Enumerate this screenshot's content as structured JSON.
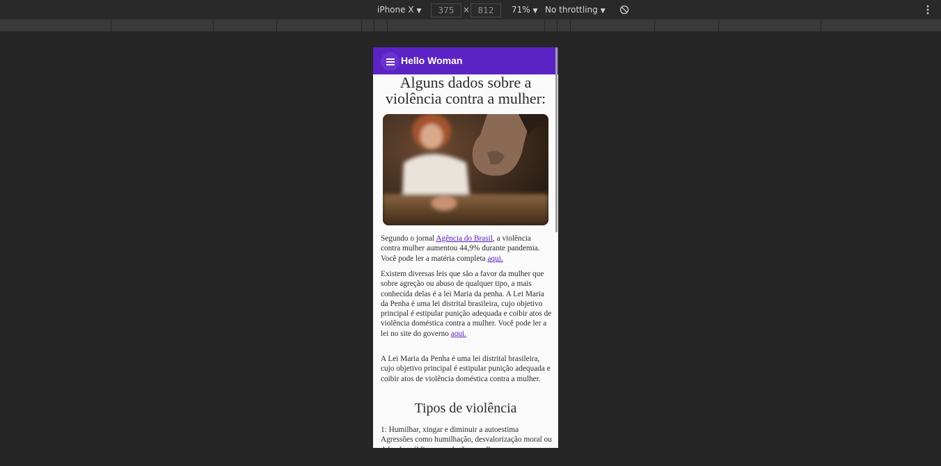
{
  "devtools": {
    "device": "iPhone X",
    "width": "375",
    "separator": "×",
    "height": "812",
    "zoom": "71%",
    "throttling": "No throttling"
  },
  "app": {
    "title": "Hello Woman",
    "accent_color": "#5b23c4"
  },
  "page": {
    "heading": "Alguns dados sobre a violência contra a mulher:",
    "para1": {
      "pre": "Segundo o jornal ",
      "link": "Agência do Brasil",
      "mid": ", a violência contra mulher aumentou 44,9% durante pandemia. Você pode ler a matéria completa ",
      "link2": "aqui."
    },
    "para2": {
      "text": "Existem diversas leis que são a favor da mulher que sobre agreção ou abuso de qualquer tipo, a mais conhecida delas é a lei Maria da penha. A Lei Maria da Penha é uma lei distrital brasileira, cujo objetivo principal é estipular punição adequada e coibir atos de violência doméstica contra a mulher. Você pode ler a lei no site do governo ",
      "link": "aqui."
    },
    "para3": "A Lei Maria da Penha é uma lei distrital brasileira, cujo objetivo principal é estipular punição adequada e coibir atos de violência doméstica contra a mulher.",
    "subheading": "Tipos de violência",
    "list_item1_title": "1: Humilhar, xingar e diminuir a autoestima",
    "list_item1_text": "Agressões como humilhação, desvalorização moral ou deboche público em relação a mulher"
  }
}
